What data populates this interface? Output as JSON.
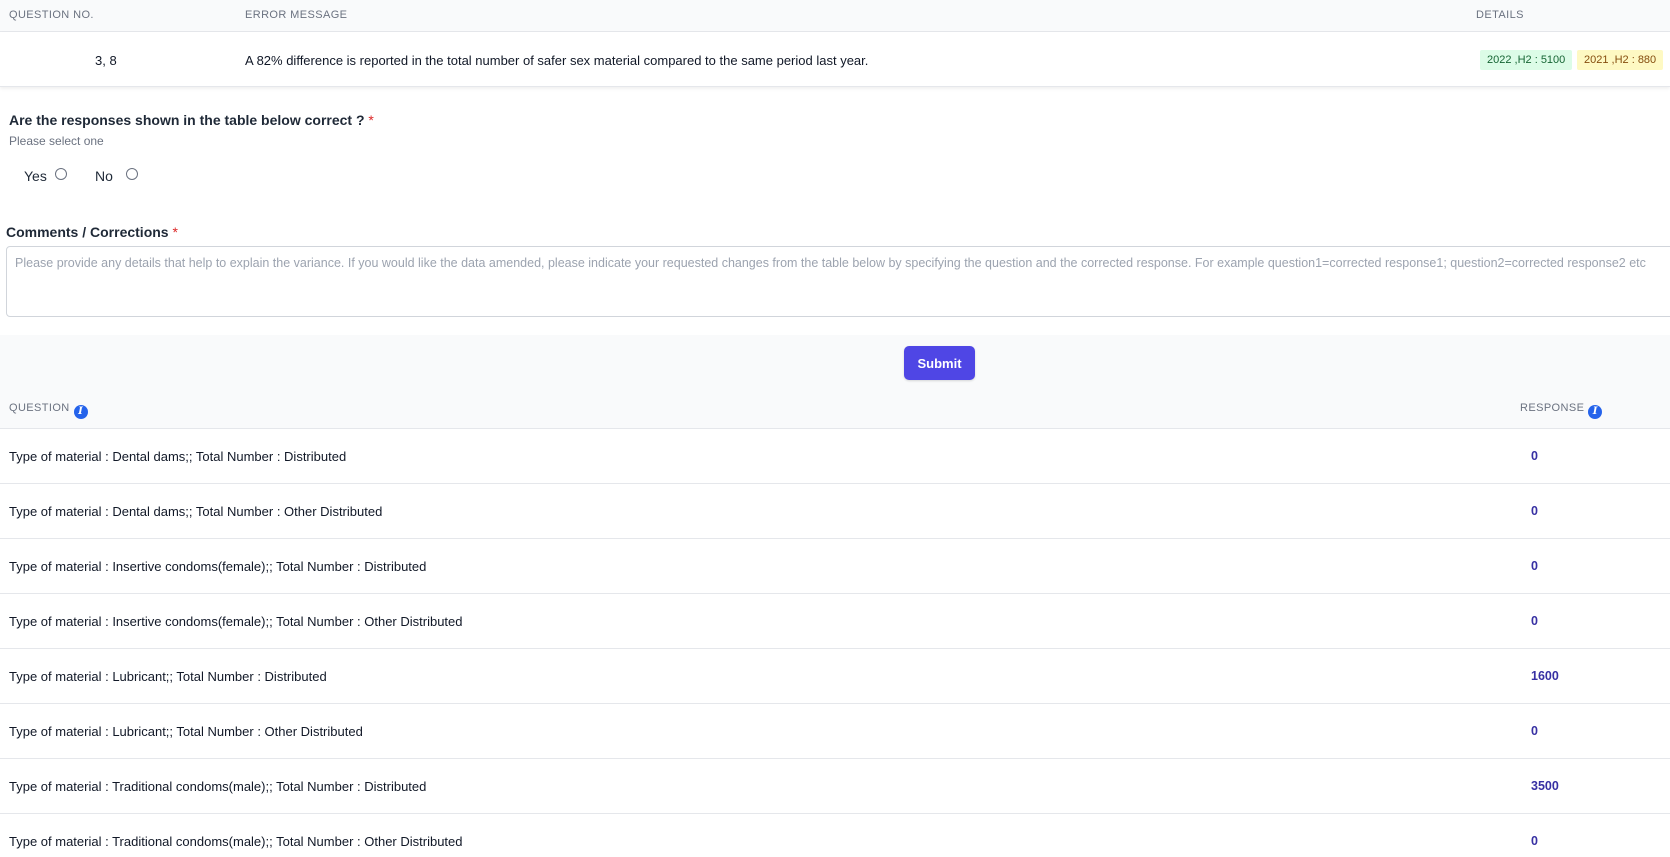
{
  "error_table": {
    "headers": {
      "question_no": "QUESTION NO.",
      "error_message": "ERROR MESSAGE",
      "details": "DETAILS"
    },
    "row": {
      "question_no": "3, 8",
      "error_message": "A 82% difference is reported in the total number of safer sex material compared to the same period last year.",
      "badge_current": "2022 ,H2 : 5100",
      "badge_previous": "2021 ,H2 : 880"
    }
  },
  "form": {
    "question": "Are the responses shown in the table below correct ?",
    "required_mark": "*",
    "hint": "Please select one",
    "option_yes": "Yes",
    "option_no": "No",
    "comments_label": "Comments / Corrections",
    "comments_placeholder": "Please provide any details that help to explain the variance. If you would like the data amended, please indicate your requested changes from the table below by specifying the question and the corrected response. For example question1=corrected response1; question2=corrected response2 etc",
    "submit_label": "Submit"
  },
  "responses_table": {
    "headers": {
      "question": "QUESTION",
      "response": "RESPONSE"
    },
    "info_icon": "i",
    "rows": [
      {
        "question": "Type of material : Dental dams;; Total Number : Distributed",
        "response": "0"
      },
      {
        "question": "Type of material : Dental dams;; Total Number : Other Distributed",
        "response": "0"
      },
      {
        "question": "Type of material : Insertive condoms(female);; Total Number : Distributed",
        "response": "0"
      },
      {
        "question": "Type of material : Insertive condoms(female);; Total Number : Other Distributed",
        "response": "0"
      },
      {
        "question": "Type of material : Lubricant;; Total Number : Distributed",
        "response": "1600"
      },
      {
        "question": "Type of material : Lubricant;; Total Number : Other Distributed",
        "response": "0"
      },
      {
        "question": "Type of material : Traditional condoms(male);; Total Number : Distributed",
        "response": "3500"
      },
      {
        "question": "Type of material : Traditional condoms(male);; Total Number : Other Distributed",
        "response": "0"
      }
    ]
  },
  "colors": {
    "primary": "#4f46e5",
    "info": "#2563eb",
    "required": "#dc2626",
    "badge_green": "#dcfce7",
    "badge_yellow": "#fef9c3"
  }
}
